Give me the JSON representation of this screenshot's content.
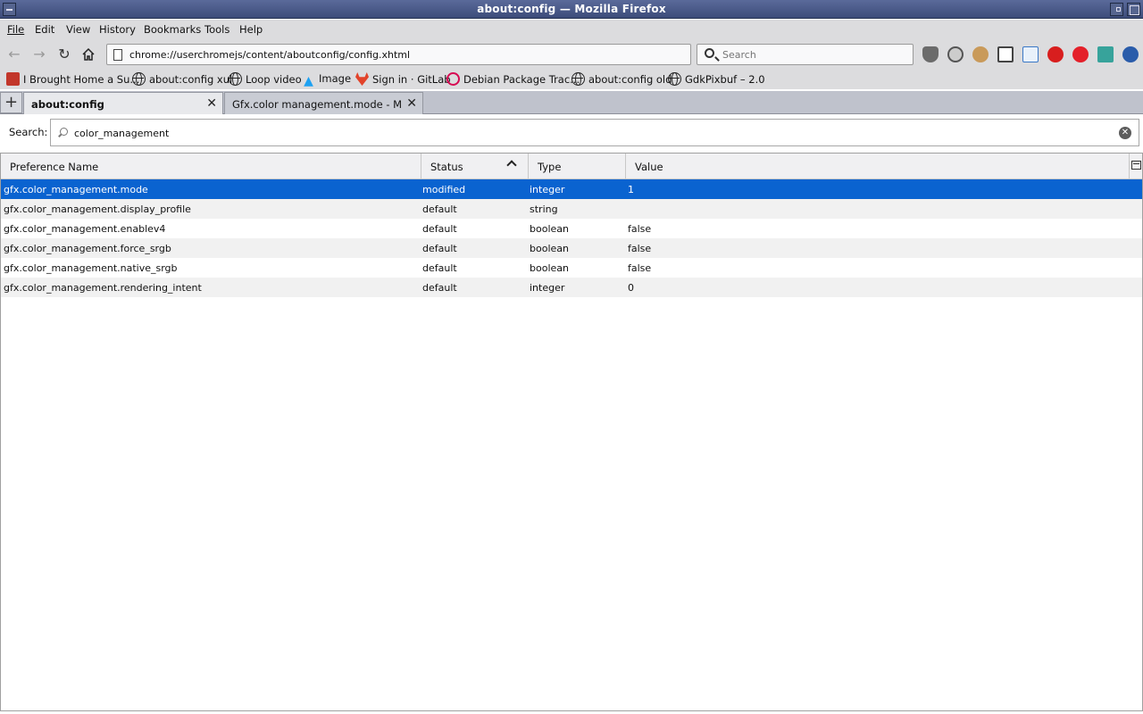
{
  "window": {
    "title": "about:config — Mozilla Firefox"
  },
  "menu": [
    {
      "label": "File",
      "underline": "F"
    },
    {
      "label": "Edit",
      "underline": "E"
    },
    {
      "label": "View",
      "underline": "V"
    },
    {
      "label": "History",
      "underline": "H"
    },
    {
      "label": "Bookmarks",
      "underline": "B"
    },
    {
      "label": "Tools",
      "underline": "T"
    },
    {
      "label": "Help",
      "underline": "H"
    }
  ],
  "nav": {
    "url": "chrome://userchromejs/content/aboutconfig/config.xhtml",
    "search_placeholder": "Search"
  },
  "bookmarks": [
    {
      "label": "I Brought Home a Su...",
      "icon": "favicon-icon"
    },
    {
      "label": "about:config xul",
      "icon": "globe-icon"
    },
    {
      "label": "Loop video",
      "icon": "globe-icon"
    },
    {
      "label": "Image",
      "icon": "twitter-icon"
    },
    {
      "label": "Sign in · GitLab",
      "icon": "gitlab-icon"
    },
    {
      "label": "Debian Package Trac...",
      "icon": "debian-icon"
    },
    {
      "label": "about:config old",
      "icon": "globe-icon"
    },
    {
      "label": "GdkPixbuf – 2.0",
      "icon": "globe-icon"
    }
  ],
  "tabs": [
    {
      "label": "about:config",
      "active": true
    },
    {
      "label": "Gfx.color management.mode - MozillaZine",
      "active": false
    }
  ],
  "config": {
    "search_label": "Search:",
    "search_value": "color_management",
    "columns": {
      "name": "Preference Name",
      "status": "Status",
      "type": "Type",
      "value": "Value"
    },
    "rows": [
      {
        "name": "gfx.color_management.mode",
        "status": "modified",
        "type": "integer",
        "value": "1"
      },
      {
        "name": "gfx.color_management.display_profile",
        "status": "default",
        "type": "string",
        "value": ""
      },
      {
        "name": "gfx.color_management.enablev4",
        "status": "default",
        "type": "boolean",
        "value": "false"
      },
      {
        "name": "gfx.color_management.force_srgb",
        "status": "default",
        "type": "boolean",
        "value": "false"
      },
      {
        "name": "gfx.color_management.native_srgb",
        "status": "default",
        "type": "boolean",
        "value": "false"
      },
      {
        "name": "gfx.color_management.rendering_intent",
        "status": "default",
        "type": "integer",
        "value": "0"
      }
    ]
  },
  "colors": {
    "selection": "#0a63d0",
    "titlebar": "#4a5a8a"
  }
}
